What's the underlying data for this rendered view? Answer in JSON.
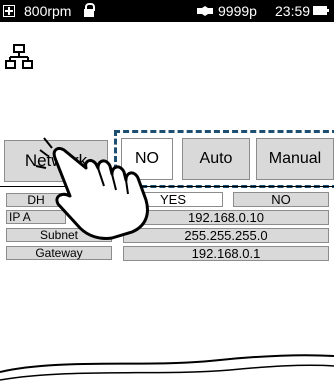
{
  "status_bar": {
    "rpm": "800rpm",
    "points": "9999p",
    "time": "23:59"
  },
  "icons": {
    "status_box": "plus-box-icon",
    "lock": "lock-icon",
    "connection": "connection-icon",
    "battery": "battery-icon",
    "network": "network-tree-icon",
    "hand": "pointing-hand-icon"
  },
  "network_row": {
    "label": "Network",
    "options": [
      "NO",
      "Auto",
      "Manual"
    ],
    "selected": "NO"
  },
  "fields": {
    "dhcp_label": "DH",
    "dhcp_yes": "YES",
    "dhcp_no": "NO",
    "ip_label": "IP A",
    "ip_value": "192.168.0.10",
    "subnet_label": "Subnet",
    "subnet_value": "255.255.255.0",
    "gateway_label": "Gateway",
    "gateway_value": "192.168.0.1"
  },
  "colors": {
    "highlight_border": "#1d4f73",
    "button_gray": "#d9d9d9",
    "status_bar": "#000000"
  }
}
